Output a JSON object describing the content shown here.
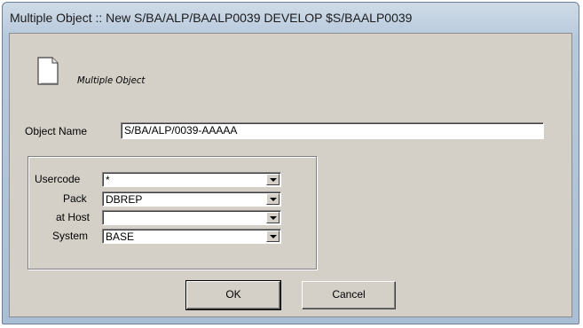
{
  "window": {
    "title": "Multiple Object :: New S/BA/ALP/BAALP0039 DEVELOP $S/BAALP0039"
  },
  "header": {
    "icon": "document-icon",
    "caption": "Multiple Object"
  },
  "object_name": {
    "label": "Object Name",
    "value": "S/BA/ALP/0039-AAAAA"
  },
  "fields": {
    "usercode": {
      "label": "Usercode",
      "value": "*"
    },
    "pack": {
      "label": "Pack",
      "value": "DBREP"
    },
    "host": {
      "label": "at Host",
      "value": ""
    },
    "system": {
      "label": "System",
      "value": "BASE"
    }
  },
  "buttons": {
    "ok": "OK",
    "cancel": "Cancel"
  }
}
